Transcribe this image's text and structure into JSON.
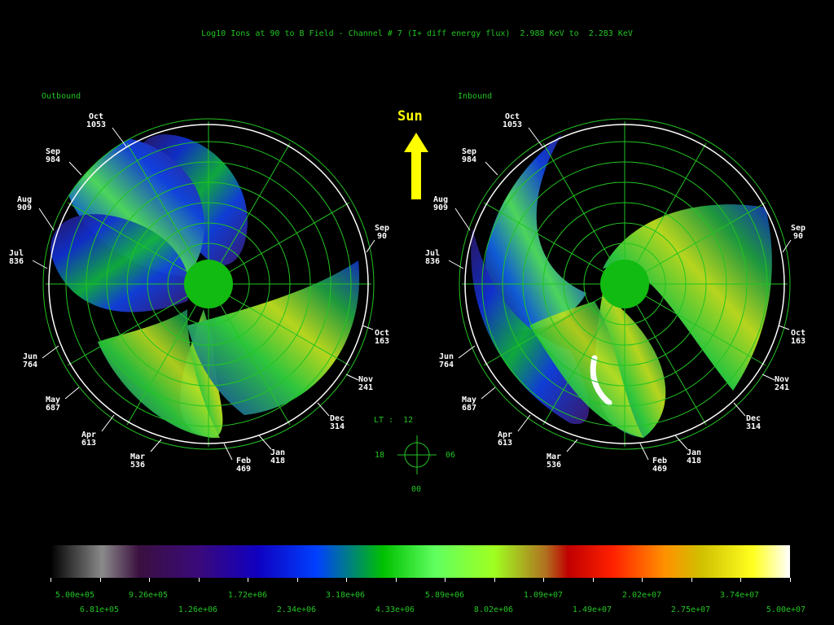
{
  "title": "Log10 Ions at 90 to B Field - Channel # 7 (I+ diff energy flux)  2.988 KeV to  2.283 KeV",
  "panels": [
    {
      "label": "Outbound",
      "months": [
        {
          "m": "Oct",
          "d": "1053"
        },
        {
          "m": "Sep",
          "d": "984"
        },
        {
          "m": "Aug",
          "d": "909"
        },
        {
          "m": "Jul",
          "d": "836"
        },
        {
          "m": "Jun",
          "d": "764"
        },
        {
          "m": "May",
          "d": "687"
        },
        {
          "m": "Apr",
          "d": "613"
        },
        {
          "m": "Mar",
          "d": "536"
        },
        {
          "m": "Feb",
          "d": "469"
        },
        {
          "m": "Jan",
          "d": "418"
        },
        {
          "m": "Dec",
          "d": "314"
        },
        {
          "m": "Nov",
          "d": "241"
        },
        {
          "m": "Oct",
          "d": "163"
        },
        {
          "m": "Sep",
          "d": "90"
        }
      ]
    },
    {
      "label": "Inbound",
      "months": [
        {
          "m": "Oct",
          "d": "1053"
        },
        {
          "m": "Sep",
          "d": "984"
        },
        {
          "m": "Aug",
          "d": "909"
        },
        {
          "m": "Jul",
          "d": "836"
        },
        {
          "m": "Jun",
          "d": "764"
        },
        {
          "m": "May",
          "d": "687"
        },
        {
          "m": "Apr",
          "d": "613"
        },
        {
          "m": "Mar",
          "d": "536"
        },
        {
          "m": "Feb",
          "d": "469"
        },
        {
          "m": "Jan",
          "d": "418"
        },
        {
          "m": "Dec",
          "d": "314"
        },
        {
          "m": "Nov",
          "d": "241"
        },
        {
          "m": "Oct",
          "d": "163"
        },
        {
          "m": "Sep",
          "d": "90"
        }
      ]
    }
  ],
  "sun_label": "Sun",
  "lt": {
    "label": "LT :  12",
    "left": "18",
    "right": "06",
    "bottom": "00"
  },
  "colorbar": {
    "top_labels": [
      "5.00e+05",
      "9.26e+05",
      "1.72e+06",
      "3.18e+06",
      "5.89e+06",
      "1.09e+07",
      "2.02e+07",
      "3.74e+07"
    ],
    "bottom_labels": [
      "6.81e+05",
      "1.26e+06",
      "2.34e+06",
      "4.33e+06",
      "8.02e+06",
      "1.49e+07",
      "2.75e+07",
      "5.00e+07"
    ]
  },
  "colors": {
    "text": "#22c422",
    "grid": "#22c422",
    "sun": "#ffff00",
    "earth": "#11bb11"
  }
}
